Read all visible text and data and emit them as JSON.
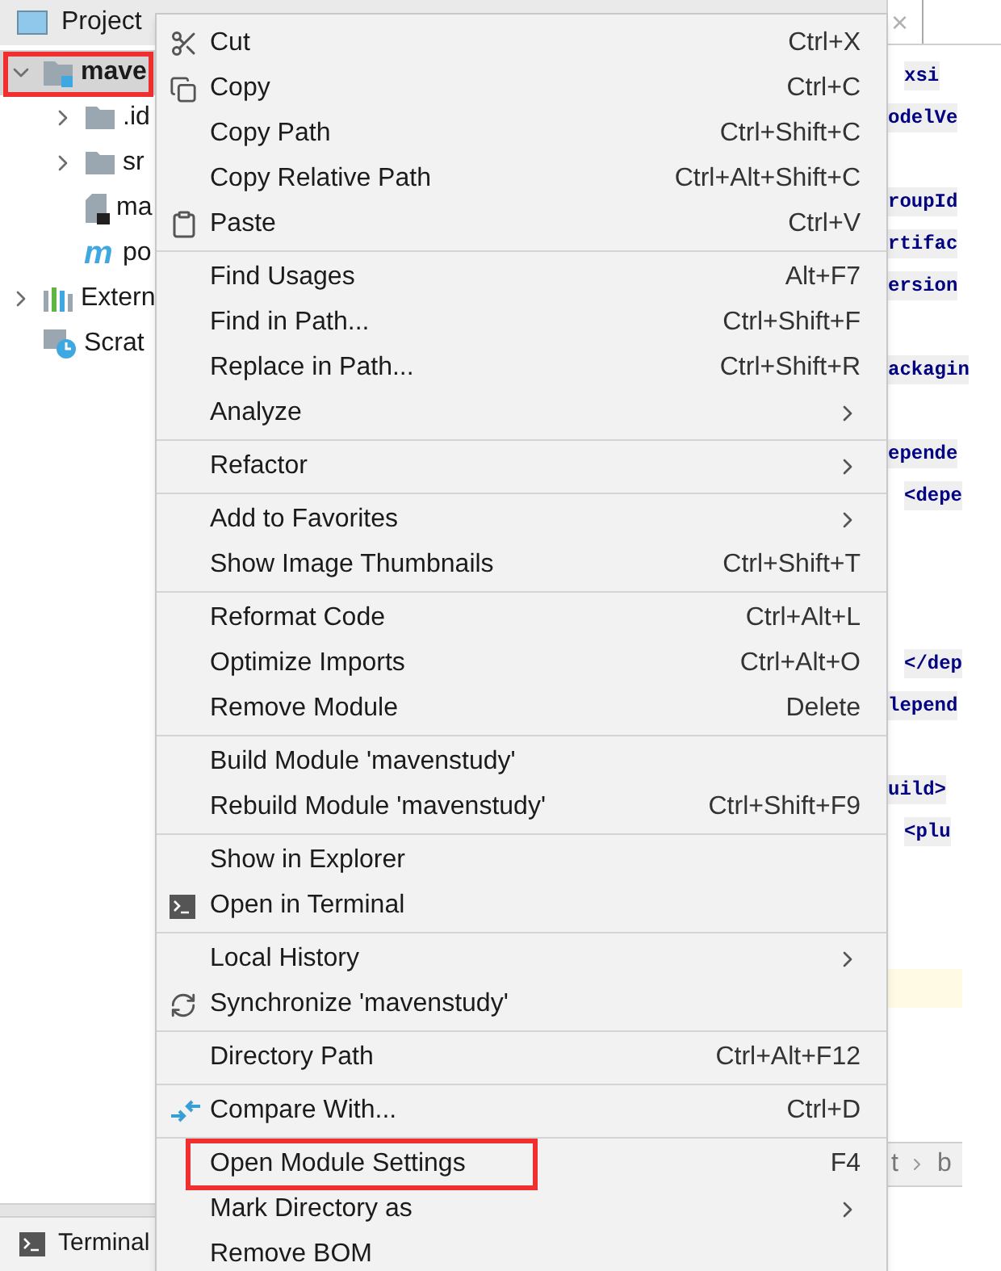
{
  "project_panel": {
    "title": "Project",
    "tree": [
      {
        "label": "mave",
        "kind": "module",
        "expanded": true,
        "selected": true,
        "highlighted": true,
        "children": [
          {
            "label": ".id",
            "kind": "folder",
            "expanded": false
          },
          {
            "label": "sr",
            "kind": "folder",
            "expanded": false
          },
          {
            "label": "ma",
            "kind": "file"
          },
          {
            "label": "po",
            "kind": "maven",
            "badge": "m"
          }
        ]
      },
      {
        "label": "Extern",
        "kind": "library",
        "expanded": false
      },
      {
        "label": "Scrat",
        "kind": "scratch"
      }
    ]
  },
  "editor": {
    "tab_close": "×",
    "lines": [
      {
        "kind": "code",
        "text": "xsi",
        "indent": true
      },
      {
        "kind": "code",
        "text": "odelVe"
      },
      {
        "kind": "blank"
      },
      {
        "kind": "code",
        "text": "roupId"
      },
      {
        "kind": "code",
        "text": "rtifac"
      },
      {
        "kind": "code",
        "text": "ersion"
      },
      {
        "kind": "blank"
      },
      {
        "kind": "code",
        "text": "ackagin"
      },
      {
        "kind": "blank"
      },
      {
        "kind": "code",
        "text": "epende"
      },
      {
        "kind": "code",
        "text": "<depe",
        "indent": true
      },
      {
        "kind": "blank"
      },
      {
        "kind": "blank"
      },
      {
        "kind": "blank"
      },
      {
        "kind": "code",
        "text": "</dep",
        "indent": true
      },
      {
        "kind": "code",
        "text": "lepend"
      },
      {
        "kind": "blank"
      },
      {
        "kind": "code",
        "text": "uild>"
      },
      {
        "kind": "code",
        "text": "<plu",
        "indent": true
      }
    ],
    "breadcrumbs": [
      "t",
      "b"
    ]
  },
  "bottom_bar": {
    "tab": "Terminal"
  },
  "context_menu": {
    "groups": [
      [
        {
          "label": "Cut",
          "shortcut": "Ctrl+X",
          "kind": "cut"
        },
        {
          "label": "Copy",
          "shortcut": "Ctrl+C",
          "kind": "copy"
        },
        {
          "label": "Copy Path",
          "shortcut": "Ctrl+Shift+C",
          "kind": "plain"
        },
        {
          "label": "Copy Relative Path",
          "shortcut": "Ctrl+Alt+Shift+C",
          "kind": "plain"
        },
        {
          "label": "Paste",
          "shortcut": "Ctrl+V",
          "kind": "paste"
        }
      ],
      [
        {
          "label": "Find Usages",
          "shortcut": "Alt+F7",
          "kind": "plain"
        },
        {
          "label": "Find in Path...",
          "shortcut": "Ctrl+Shift+F",
          "kind": "plain"
        },
        {
          "label": "Replace in Path...",
          "shortcut": "Ctrl+Shift+R",
          "kind": "plain"
        },
        {
          "label": "Analyze",
          "submenu": true,
          "kind": "plain"
        }
      ],
      [
        {
          "label": "Refactor",
          "submenu": true,
          "kind": "plain"
        }
      ],
      [
        {
          "label": "Add to Favorites",
          "submenu": true,
          "kind": "plain"
        },
        {
          "label": "Show Image Thumbnails",
          "shortcut": "Ctrl+Shift+T",
          "kind": "plain"
        }
      ],
      [
        {
          "label": "Reformat Code",
          "shortcut": "Ctrl+Alt+L",
          "kind": "plain"
        },
        {
          "label": "Optimize Imports",
          "shortcut": "Ctrl+Alt+O",
          "kind": "plain"
        },
        {
          "label": "Remove Module",
          "shortcut": "Delete",
          "kind": "plain"
        }
      ],
      [
        {
          "label": "Build Module 'mavenstudy'",
          "kind": "plain"
        },
        {
          "label": "Rebuild Module 'mavenstudy'",
          "shortcut": "Ctrl+Shift+F9",
          "kind": "plain"
        }
      ],
      [
        {
          "label": "Show in Explorer",
          "kind": "plain"
        },
        {
          "label": "Open in Terminal",
          "kind": "terminal"
        }
      ],
      [
        {
          "label": "Local History",
          "submenu": true,
          "kind": "plain"
        },
        {
          "label": "Synchronize 'mavenstudy'",
          "kind": "sync"
        }
      ],
      [
        {
          "label": "Directory Path",
          "shortcut": "Ctrl+Alt+F12",
          "kind": "plain"
        }
      ],
      [
        {
          "label": "Compare With...",
          "shortcut": "Ctrl+D",
          "kind": "compare"
        }
      ],
      [
        {
          "label": "Open Module Settings",
          "shortcut": "F4",
          "highlighted": true,
          "kind": "plain"
        },
        {
          "label": "Mark Directory as",
          "submenu": true,
          "kind": "plain"
        },
        {
          "label": "Remove BOM",
          "kind": "plain"
        }
      ]
    ]
  }
}
